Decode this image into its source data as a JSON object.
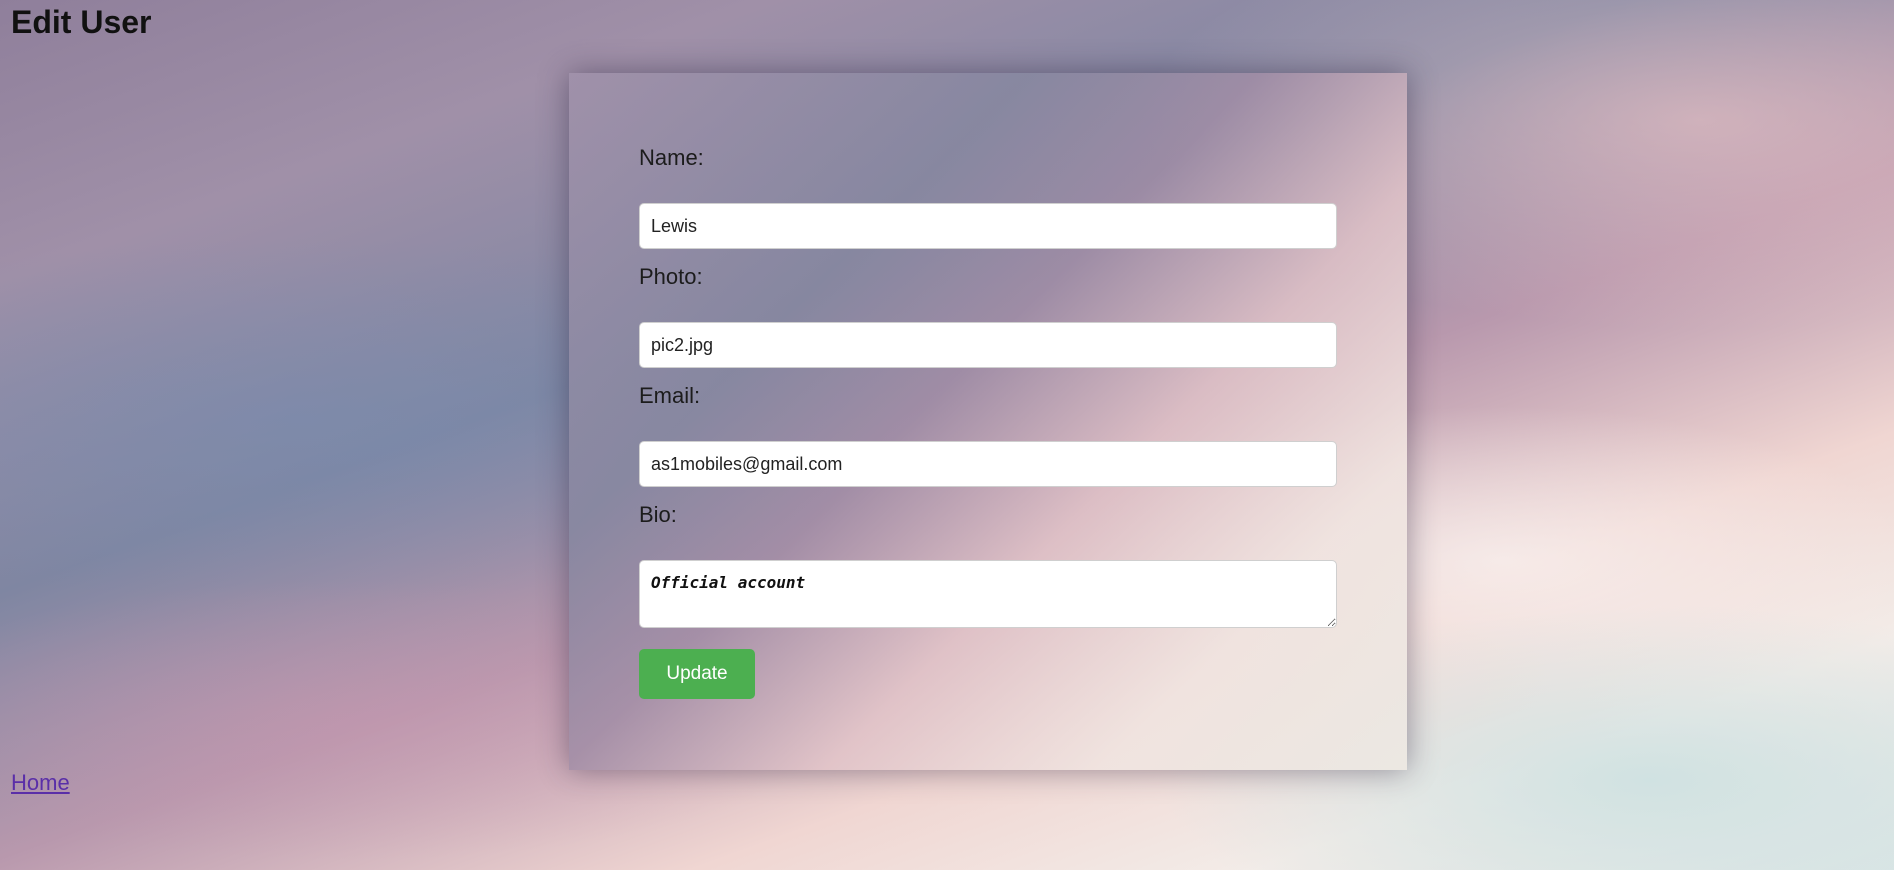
{
  "page": {
    "title": "Edit User"
  },
  "form": {
    "name_label": "Name:",
    "name_value": "Lewis",
    "photo_label": "Photo:",
    "photo_value": "pic2.jpg",
    "email_label": "Email:",
    "email_value": "as1mobiles@gmail.com",
    "bio_label": "Bio:",
    "bio_value": "Official account",
    "update_label": "Update"
  },
  "nav": {
    "home_label": "Home"
  },
  "colors": {
    "button_bg": "#4caf50",
    "link": "#5a2fa8"
  }
}
